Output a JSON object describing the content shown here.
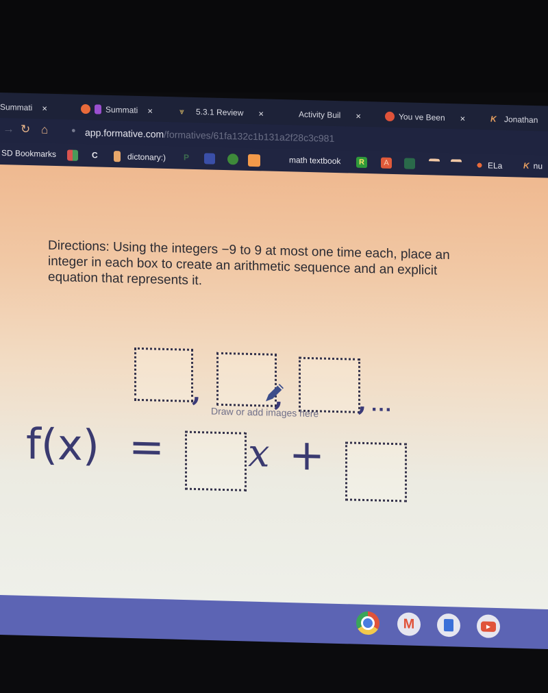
{
  "browser": {
    "tabs": [
      {
        "label": "Summati",
        "close": "×",
        "icon": "formative-icon"
      },
      {
        "label": "Summati",
        "close": "×",
        "icon": "formative-icon"
      },
      {
        "label": "5.3.1 Review",
        "close": "×",
        "icon": "bookmark-logo-icon"
      },
      {
        "label": "Activity Buil",
        "close": "×",
        "icon": "desmos-icon"
      },
      {
        "label": "You ve Been",
        "close": "×",
        "icon": "record-icon"
      },
      {
        "label": "Jonathan",
        "icon": "k-icon"
      }
    ],
    "address": {
      "domain": "app.formative.com",
      "path": "/formatives/61fa132c1b131a2f28c3c981"
    },
    "bookmarks": [
      {
        "label": "SD Bookmarks"
      },
      {
        "label": ""
      },
      {
        "label": "C"
      },
      {
        "label": "dictonary:)"
      },
      {
        "label": "P"
      },
      {
        "label": ""
      },
      {
        "label": ""
      },
      {
        "label": ""
      },
      {
        "label": "math textbook"
      },
      {
        "label": "R"
      },
      {
        "label": "A"
      },
      {
        "label": ""
      },
      {
        "label": ""
      },
      {
        "label": ""
      },
      {
        "label": "ELa"
      },
      {
        "label": "nu"
      }
    ]
  },
  "question": {
    "directions": "Directions: Using the integers −9 to 9 at most one time each, place an integer in each box to create an arithmetic sequence and an explicit equation that represents it.",
    "sequence_comma": ",",
    "sequence_ellipsis": "...",
    "draw_hint": "Draw or add images here",
    "equation_lhs": "f(x)",
    "equation_eq": "=",
    "equation_var": "x",
    "equation_plus": "+"
  },
  "shelf": {
    "apps": [
      "chrome",
      "gmail",
      "docs",
      "youtube"
    ]
  },
  "colors": {
    "accent": "#3a3a70",
    "shelf": "#5c64b4",
    "tabstrip": "#1d2238"
  }
}
